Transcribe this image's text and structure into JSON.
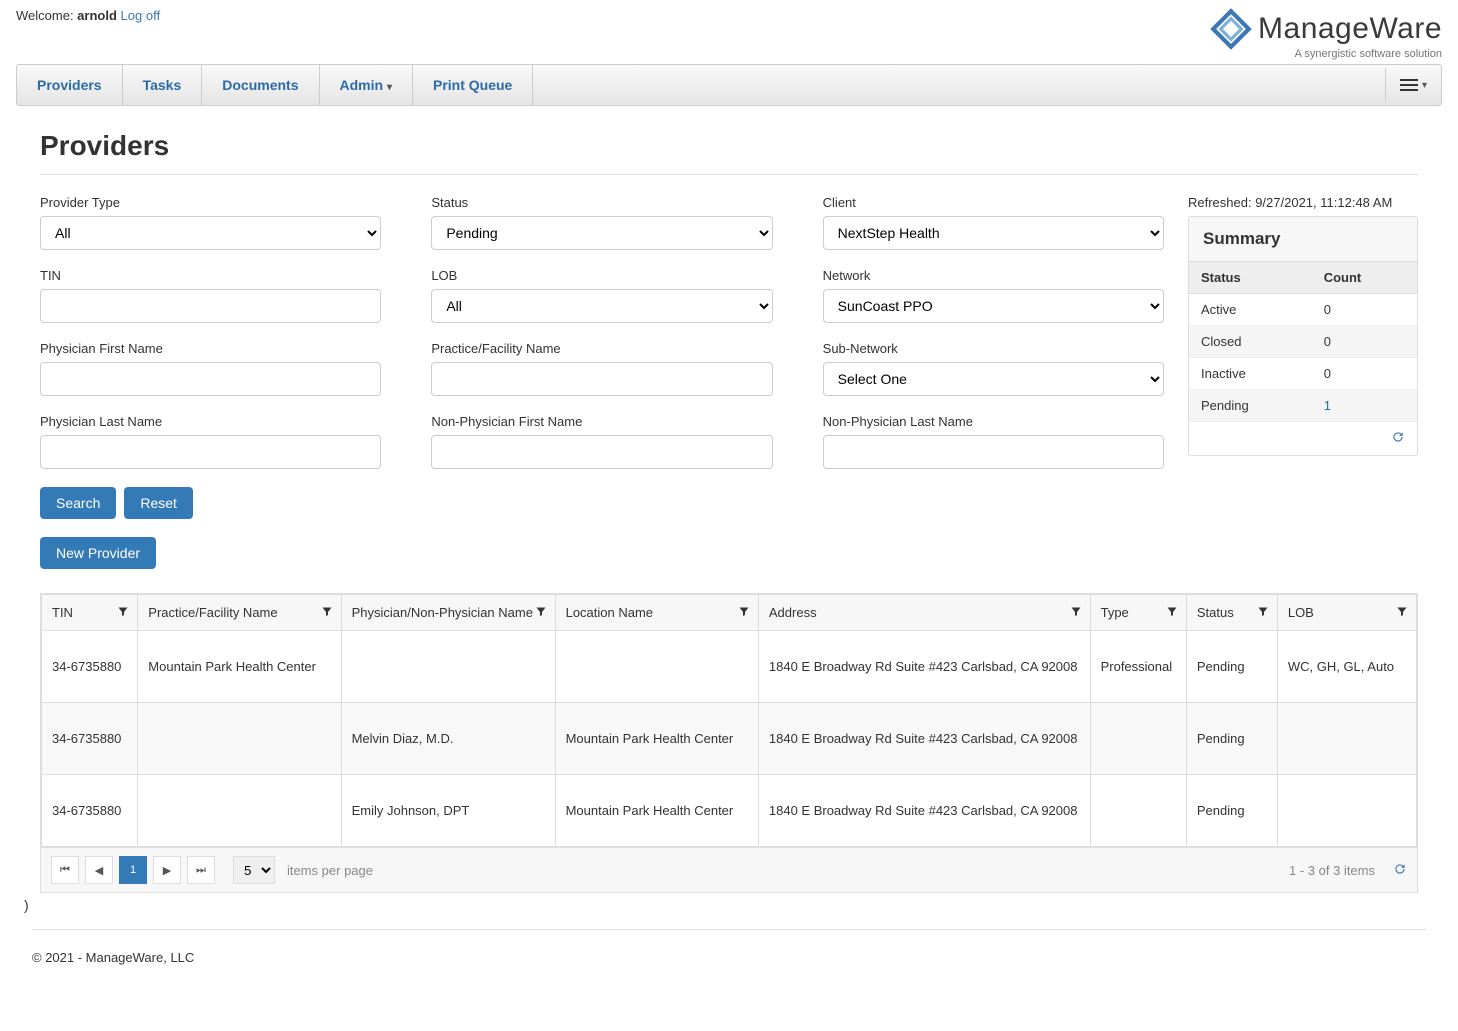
{
  "header": {
    "welcome_prefix": "Welcome: ",
    "username": "arnold",
    "logoff": "Log off",
    "brand_primary": "Manage",
    "brand_secondary": "Ware",
    "tagline": "A synergistic software solution"
  },
  "nav": {
    "items": [
      "Providers",
      "Tasks",
      "Documents",
      "Admin",
      "Print Queue"
    ],
    "admin_caret": "▾"
  },
  "page": {
    "title": "Providers"
  },
  "filters": {
    "provider_type": {
      "label": "Provider Type",
      "value": "All"
    },
    "status": {
      "label": "Status",
      "value": "Pending"
    },
    "client": {
      "label": "Client",
      "value": "NextStep Health"
    },
    "tin": {
      "label": "TIN",
      "value": ""
    },
    "lob": {
      "label": "LOB",
      "value": "All"
    },
    "network": {
      "label": "Network",
      "value": "SunCoast PPO"
    },
    "phys_first": {
      "label": "Physician First Name",
      "value": ""
    },
    "practice": {
      "label": "Practice/Facility Name",
      "value": ""
    },
    "subnetwork": {
      "label": "Sub-Network",
      "value": "Select One"
    },
    "phys_last": {
      "label": "Physician Last Name",
      "value": ""
    },
    "np_first": {
      "label": "Non-Physician First Name",
      "value": ""
    },
    "np_last": {
      "label": "Non-Physician Last Name",
      "value": ""
    }
  },
  "buttons": {
    "search": "Search",
    "reset": "Reset",
    "new_provider": "New Provider"
  },
  "summary": {
    "refreshed_label": "Refreshed: 9/27/2021, 11:12:48 AM",
    "title": "Summary",
    "col_status": "Status",
    "col_count": "Count",
    "rows": [
      {
        "status": "Active",
        "count": "0"
      },
      {
        "status": "Closed",
        "count": "0"
      },
      {
        "status": "Inactive",
        "count": "0"
      },
      {
        "status": "Pending",
        "count": "1",
        "link": true
      }
    ]
  },
  "grid": {
    "columns": [
      "TIN",
      "Practice/Facility Name",
      "Physician/Non-Physician Name",
      "Location Name",
      "Address",
      "Type",
      "Status",
      "LOB"
    ],
    "rows": [
      {
        "tin": "34-6735880",
        "practice": "Mountain Park Health Center",
        "physician": "",
        "location": "",
        "address": "1840 E Broadway Rd Suite #423 Carlsbad, CA 92008",
        "type": "Professional",
        "status": "Pending",
        "lob": "WC, GH, GL, Auto"
      },
      {
        "tin": "34-6735880",
        "practice": "",
        "physician": "Melvin Diaz, M.D.",
        "location": "Mountain Park Health Center",
        "address": "1840 E Broadway Rd Suite #423 Carlsbad, CA 92008",
        "type": "",
        "status": "Pending",
        "lob": ""
      },
      {
        "tin": "34-6735880",
        "practice": "",
        "physician": "Emily Johnson, DPT",
        "location": "Mountain Park Health Center",
        "address": "1840 E Broadway Rd Suite #423 Carlsbad, CA 92008",
        "type": "",
        "status": "Pending",
        "lob": ""
      }
    ]
  },
  "pager": {
    "page": "1",
    "page_size": "5",
    "per_page_label": "items per page",
    "info": "1 - 3 of 3 items"
  },
  "stray": ")",
  "footer": "© 2021 - ManageWare, LLC"
}
